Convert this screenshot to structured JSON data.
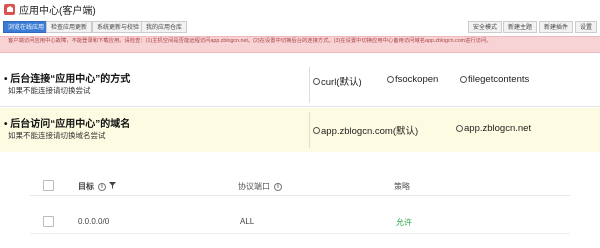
{
  "app": {
    "title": "应用中心(客户端)"
  },
  "tabs": [
    {
      "label": "浏览在线应用",
      "active": true
    },
    {
      "label": "检查应用更新",
      "active": false
    },
    {
      "label": "系统更新与校验",
      "active": false
    },
    {
      "label": "我的应用仓库",
      "active": false
    }
  ],
  "tools": [
    {
      "label": "安全模式"
    },
    {
      "label": "新建主题"
    },
    {
      "label": "新建插件"
    },
    {
      "label": "设置"
    }
  ],
  "alert": {
    "text": "客户端访问应用中心故障，不能登录和下载应用。请检查：(1)主机空间是否能远程访问app.zblogcn.net。(2)在设置中切换后台的连接方式。(3)在设置中切换应用中心备用访问域名app.zblogcn.com进行访问。"
  },
  "options": [
    {
      "label": "• 后台连接“应用中心”的方式",
      "desc": "如果不能连接请切换尝试",
      "choices": [
        "curl(默认)",
        "fsockopen",
        "filegetcontents"
      ]
    },
    {
      "label": "• 后台访问“应用中心”的域名",
      "desc": "如果不能连接请切换域名尝试",
      "choices": [
        "app.zblogcn.com(默认)",
        "app.zblogcn.net"
      ]
    }
  ],
  "table": {
    "headers": [
      "目标",
      "协议端口",
      "策略"
    ],
    "rows": [
      {
        "target": "0.0.0.0/0",
        "port": "ALL",
        "policy": "允许"
      }
    ]
  },
  "colors": {
    "accent": "#3a7bd5",
    "alert_bg": "#f8d3d5",
    "alert_text": "#a94442",
    "allow": "#29a745",
    "highlight_row": "#fdfbe1"
  }
}
